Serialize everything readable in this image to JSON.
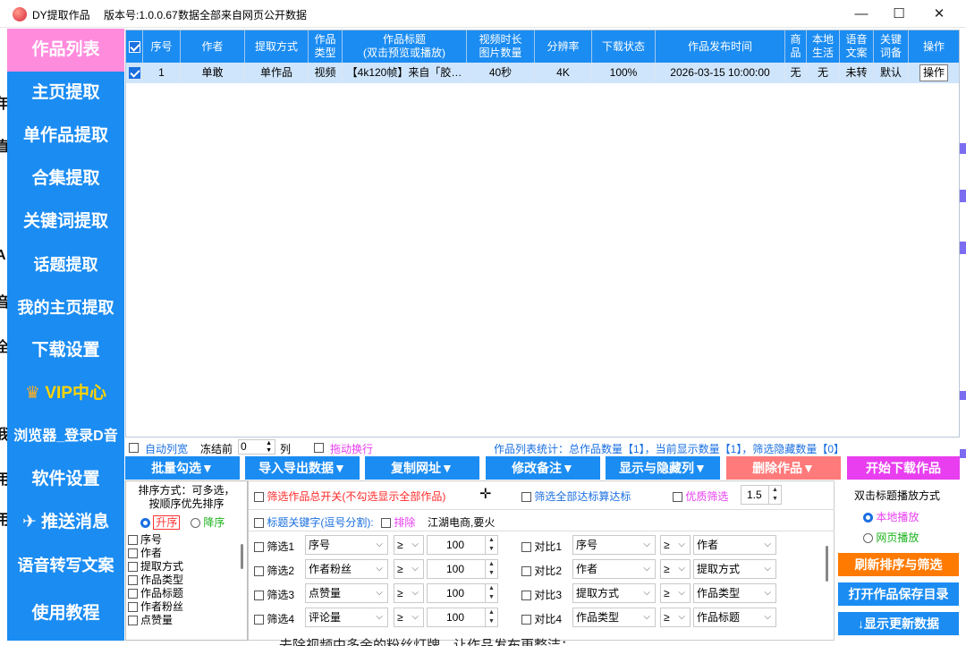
{
  "window": {
    "title": "DY提取作品",
    "version": "版本号:1.0.0.67",
    "notice": "数据全部来自网页公开数据",
    "minimize": "—",
    "maximize": "☐",
    "close": "✕"
  },
  "sidebar": {
    "items": [
      {
        "label": "作品列表",
        "active": true
      },
      {
        "label": "主页提取"
      },
      {
        "label": "单作品提取"
      },
      {
        "label": "合集提取"
      },
      {
        "label": "关键词提取"
      },
      {
        "label": "话题提取"
      },
      {
        "label": "我的主页提取"
      },
      {
        "label": "下载设置"
      },
      {
        "label": "VIP中心"
      },
      {
        "label": "浏览器_登录D音"
      },
      {
        "label": "软件设置"
      },
      {
        "label": "推送消息"
      },
      {
        "label": "语音转写文案"
      },
      {
        "label": "使用教程"
      }
    ]
  },
  "table": {
    "headers": [
      {
        "label": "序号"
      },
      {
        "label": "作者"
      },
      {
        "label": "提取方式"
      },
      {
        "label": "作品\n类型"
      },
      {
        "label": "作品标题\n(双击预览或播放)"
      },
      {
        "label": "视频时长\n图片数量"
      },
      {
        "label": "分辨率"
      },
      {
        "label": "下载状态"
      },
      {
        "label": "作品发布时间"
      },
      {
        "label": "商\n品"
      },
      {
        "label": "本地\n生活"
      },
      {
        "label": "语音\n文案"
      },
      {
        "label": "关键\n词备"
      },
      {
        "label": "操作"
      }
    ],
    "rows": [
      {
        "checked": true,
        "cells": [
          "1",
          "单敢",
          "单作品",
          "视频",
          "【4k120帧】来自「胶…",
          "40秒",
          "4K",
          "100%",
          "2026-03-15 10:00:00",
          "无",
          "无",
          "未转",
          "默认",
          "操作"
        ]
      }
    ]
  },
  "statusbar": {
    "auto_col_width": "自动列宽",
    "freeze_front": "冻结前",
    "freeze_value": "0",
    "column_unit": "列",
    "drag_wrap": "拖动换行",
    "stats": "作品列表统计：总作品数量【1】，当前显示数量【1】，筛选隐藏数量【0】"
  },
  "toolbar": {
    "batch_select": "批量勾选▼",
    "import_export": "导入导出数据▼",
    "copy_url": "复制网址▼",
    "edit_note": "修改备注▼",
    "show_hide_cols": "显示与隐藏列▼",
    "delete_works": "删除作品▼",
    "start_download": "开始下载作品"
  },
  "sort_panel": {
    "title": "排序方式：可多选，\n按顺序优先排序",
    "asc": "升序",
    "desc": "降序",
    "fields": [
      "序号",
      "作者",
      "提取方式",
      "作品类型",
      "作品标题",
      "作者粉丝",
      "点赞量"
    ]
  },
  "filter_panel": {
    "total_switch": "筛选作品总开关(不勾选显示全部作品)",
    "all_meet": "筛选全部达标算达标",
    "quality": "优质筛选",
    "quality_value": "1.5",
    "keywords_label": "标题关键字(逗号分割):",
    "exclude": "排除",
    "keywords_value": "江湖电商,要火",
    "filters": [
      {
        "label": "筛选1",
        "field": "序号",
        "op": "≥",
        "value": "100"
      },
      {
        "label": "筛选2",
        "field": "作者粉丝",
        "op": "≥",
        "value": "100"
      },
      {
        "label": "筛选3",
        "field": "点赞量",
        "op": "≥",
        "value": "100"
      },
      {
        "label": "筛选4",
        "field": "评论量",
        "op": "≥",
        "value": "100"
      }
    ],
    "compares": [
      {
        "label": "对比1",
        "left": "序号",
        "op": "≥",
        "right": "作者"
      },
      {
        "label": "对比2",
        "left": "作者",
        "op": "≥",
        "right": "提取方式"
      },
      {
        "label": "对比3",
        "left": "提取方式",
        "op": "≥",
        "right": "作品类型"
      },
      {
        "label": "对比4",
        "left": "作品类型",
        "op": "≥",
        "right": "作品标题"
      }
    ]
  },
  "right_panel": {
    "play_mode_title": "双击标题播放方式",
    "local_play": "本地播放",
    "web_play": "网页播放",
    "refresh": "刷新排序与筛选",
    "open_dir": "打开作品保存目录",
    "show_update": "↓显示更新数据"
  },
  "overlay_text": "去除视频中多余的粉丝灯牌，让作品发布更整洁；",
  "colors": {
    "accent": "#1b8cf2",
    "active": "#ff8bdd",
    "delete": "#ff7a7a",
    "download": "#e83ef0",
    "orange": "#ff7a00"
  }
}
